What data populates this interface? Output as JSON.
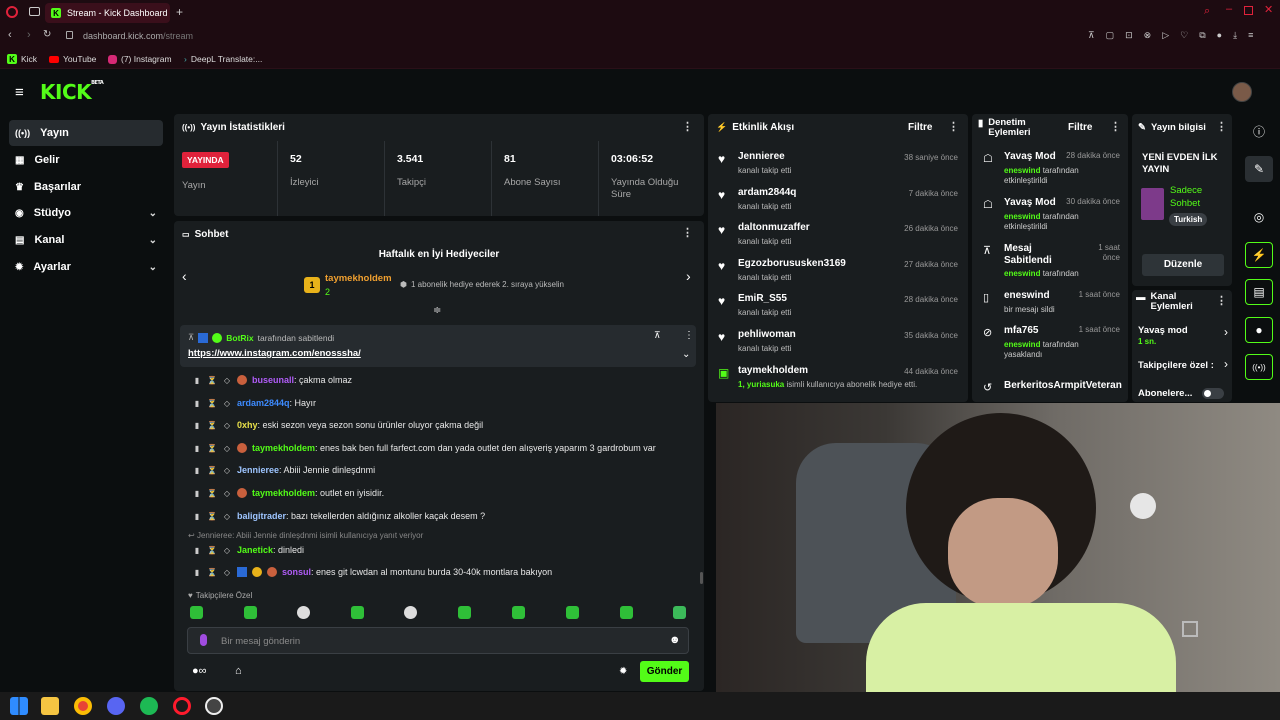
{
  "browser": {
    "tab_title": "Stream - Kick Dashboard",
    "url_host": "dashboard.kick.com",
    "url_path": "/stream",
    "bookmarks": [
      "Kick",
      "YouTube",
      "(7) Instagram",
      "DeepL Translate:..."
    ]
  },
  "brand": {
    "logo": "KICK",
    "beta": "BETA",
    "accent": "#53fc18"
  },
  "sidebar": {
    "items": [
      {
        "label": "Yayın",
        "icon": "broadcast-icon"
      },
      {
        "label": "Gelir",
        "icon": "revenue-icon"
      },
      {
        "label": "Başarılar",
        "icon": "trophy-icon"
      },
      {
        "label": "Stüdyo",
        "icon": "studio-icon"
      },
      {
        "label": "Kanal",
        "icon": "channel-icon"
      },
      {
        "label": "Ayarlar",
        "icon": "gear-icon"
      }
    ]
  },
  "stats": {
    "title": "Yayın İstatistikleri",
    "live_badge": "YAYINDA",
    "live_label": "Yayın",
    "items": [
      {
        "value": "52",
        "label": "İzleyici"
      },
      {
        "value": "3.541",
        "label": "Takipçi"
      },
      {
        "value": "81",
        "label": "Abone Sayısı"
      },
      {
        "value": "03:06:52",
        "label": "Yayında Olduğu Süre"
      }
    ]
  },
  "chat": {
    "title": "Sohbet",
    "gifters_title": "Haftalık en İyi Hediyeciler",
    "top_gifter": "taymekholdem",
    "top_gifter_count": "2",
    "gifter_hint": "1 abonelik hediye ederek 2. sıraya yükselin",
    "pinned_by": "BotRix",
    "pinned_suffix": "tarafından sabitlendi",
    "pinned_link": "https://www.instagram.com/enosssha/",
    "messages": [
      {
        "user": "buseunall",
        "color": "#b05cf7",
        "text": ": çakma olmaz"
      },
      {
        "user": "ardam2844q",
        "color": "#3d8bff",
        "text": ": Hayır"
      },
      {
        "user": "0xhy",
        "color": "#e8e04a",
        "text": ": eski sezon veya sezon sonu ürünler oluyor çakma değil"
      },
      {
        "user": "taymekholdem",
        "color": "#53fc18",
        "text": ": enes bak ben full farfect.com dan yada outlet den alışveriş yaparım 3 gardrobum var"
      },
      {
        "user": "Jennieree",
        "color": "#9ec5ff",
        "text": ": Abiii Jennie dinleşdnmi"
      },
      {
        "user": "taymekholdem",
        "color": "#53fc18",
        "text": ": outlet en iyisidir."
      },
      {
        "user": "baligitrader",
        "color": "#9ec5ff",
        "text": ": bazı tekellerden aldığınız alkoller kaçak desem ?"
      },
      {
        "user": "Janetick",
        "color": "#53fc18",
        "text": ": dinledi"
      },
      {
        "user": "sonsul",
        "color": "#b05cf7",
        "text": ": enes git lcwdan al montunu burda 30-40k montlara bakıyon"
      }
    ],
    "reply_note": "Jennieree: Abiii Jennie dinleşdnmi isimli kullanıcıya yanıt veriyor",
    "followers_only": "Takipçilere Özel",
    "input_placeholder": "Bir mesaj gönderin",
    "send_label": "Gönder"
  },
  "activity": {
    "title": "Etkinlik Akışı",
    "filter_label": "Filtre",
    "events": [
      {
        "name": "Jennieree",
        "desc": "kanalı takip etti",
        "time": "38 saniye önce"
      },
      {
        "name": "ardam2844q",
        "desc": "kanalı takip etti",
        "time": "7 dakika önce"
      },
      {
        "name": "daltonmuzaffer",
        "desc": "kanalı takip etti",
        "time": "26 dakika önce"
      },
      {
        "name": "Egzozborususken3169",
        "desc": "kanalı takip etti",
        "time": "27 dakika önce"
      },
      {
        "name": "EmiR_S55",
        "desc": "kanalı takip etti",
        "time": "28 dakika önce"
      },
      {
        "name": "pehliwoman",
        "desc": "kanalı takip etti",
        "time": "35 dakika önce"
      },
      {
        "name": "taymekholdem",
        "desc_user": "1, yuriasuka",
        "desc": "isimli kullanıcıya abonelik hediye etti.",
        "time": "44 dakika önce"
      }
    ]
  },
  "moderation": {
    "title_line1": "Denetim",
    "title_line2": "Eylemleri",
    "filter_label": "Filtre",
    "actions": [
      {
        "name": "Yavaş Mod",
        "user": "eneswind",
        "desc": "tarafından etkinleştirildi",
        "time": "28 dakika önce"
      },
      {
        "name": "Yavaş Mod",
        "user": "eneswind",
        "desc": "tarafından etkinleştirildi",
        "time": "30 dakika önce"
      },
      {
        "name": "Mesaj Sabitlendi",
        "user": "eneswind",
        "desc": "tarafından",
        "time": "1 saat önce"
      },
      {
        "name": "eneswind",
        "user": "",
        "desc": "bir mesajı sildi",
        "time": "1 saat önce"
      },
      {
        "name": "mfa765",
        "user": "eneswind",
        "desc": "tarafından yasaklandı",
        "time": "1 saat önce"
      },
      {
        "name": "BerkeritosArmpitVeteran",
        "user": "",
        "desc": "",
        "time": ""
      }
    ]
  },
  "stream_info": {
    "title": "Yayın bilgisi",
    "stream_title": "YENİ EVDEN İLK YAYIN",
    "category": "Sadece Sohbet",
    "language": "Turkish",
    "edit_label": "Düzenle"
  },
  "channel_actions": {
    "title_line1": "Kanal",
    "title_line2": "Eylemleri",
    "slow_mode": "Yavaş mod",
    "slow_mode_value": "1 sn.",
    "followers_only": "Takipçilere özel :",
    "subscribers": "Abonelere..."
  }
}
